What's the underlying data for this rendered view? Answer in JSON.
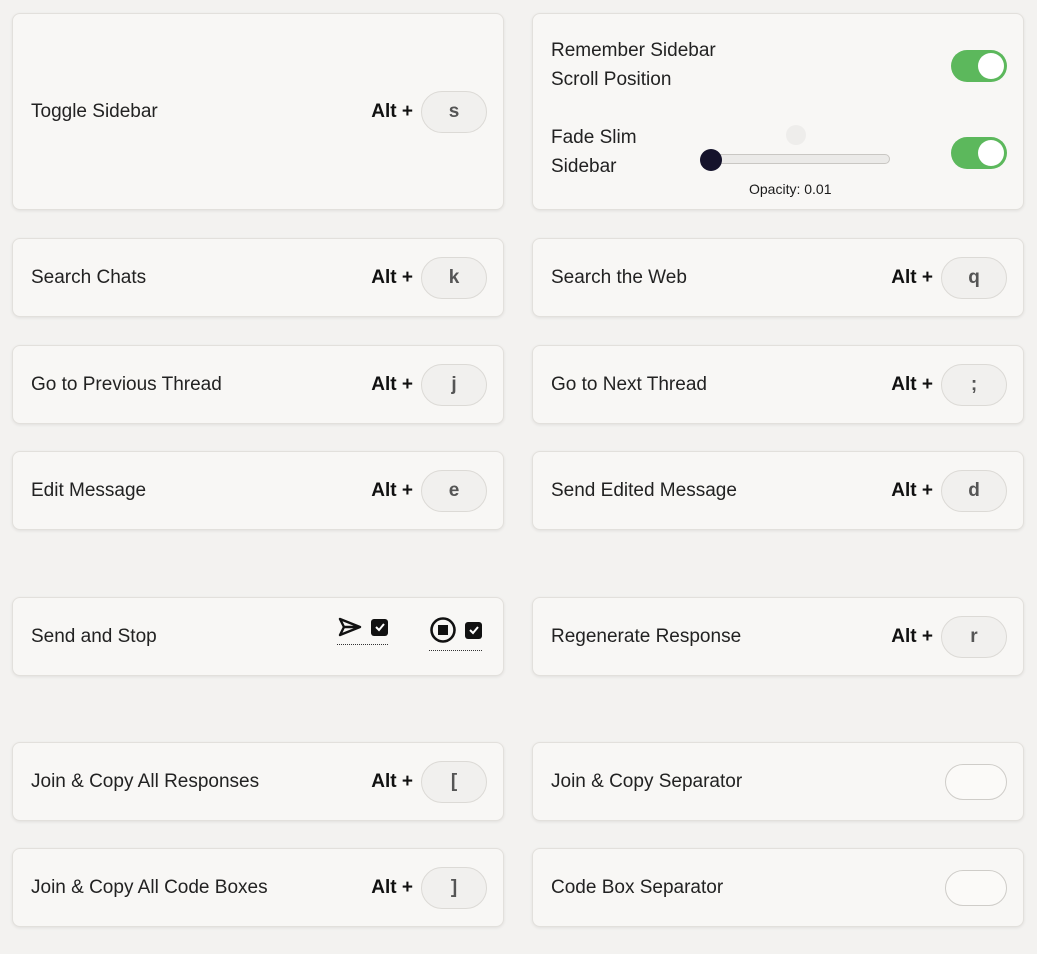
{
  "shortcuts": {
    "alt": "Alt +",
    "toggle_sidebar": {
      "label": "Toggle Sidebar",
      "key": "s"
    },
    "search_chats": {
      "label": "Search Chats",
      "key": "k"
    },
    "search_web": {
      "label": "Search the Web",
      "key": "q"
    },
    "prev_thread": {
      "label": "Go to Previous Thread",
      "key": "j"
    },
    "next_thread": {
      "label": "Go to Next Thread",
      "key": ";"
    },
    "edit_message": {
      "label": "Edit Message",
      "key": "e"
    },
    "send_edited": {
      "label": "Send Edited Message",
      "key": "d"
    },
    "send_stop": {
      "label": "Send and Stop"
    },
    "regenerate": {
      "label": "Regenerate Response",
      "key": "r"
    },
    "join_copy_responses": {
      "label": "Join & Copy All Responses",
      "key": "["
    },
    "join_copy_separator": {
      "label": "Join & Copy Separator",
      "value": ""
    },
    "join_copy_code": {
      "label": "Join & Copy All Code Boxes",
      "key": "]"
    },
    "code_separator": {
      "label": "Code Box Separator",
      "value": ""
    }
  },
  "sidebar_settings": {
    "remember_scroll": {
      "line1": "Remember Sidebar",
      "line2": "Scroll Position",
      "enabled": true
    },
    "fade_slim": {
      "line1": "Fade Slim",
      "line2": "Sidebar",
      "enabled": true
    },
    "opacity_label": "Opacity:",
    "opacity_value": "0.01"
  },
  "send_stop_icons": {
    "send": {
      "icon": "send-icon",
      "checked": true
    },
    "stop": {
      "icon": "stop-icon",
      "checked": true
    }
  },
  "colors": {
    "toggle_on": "#5cb85c",
    "slider_thumb": "#15132b"
  }
}
